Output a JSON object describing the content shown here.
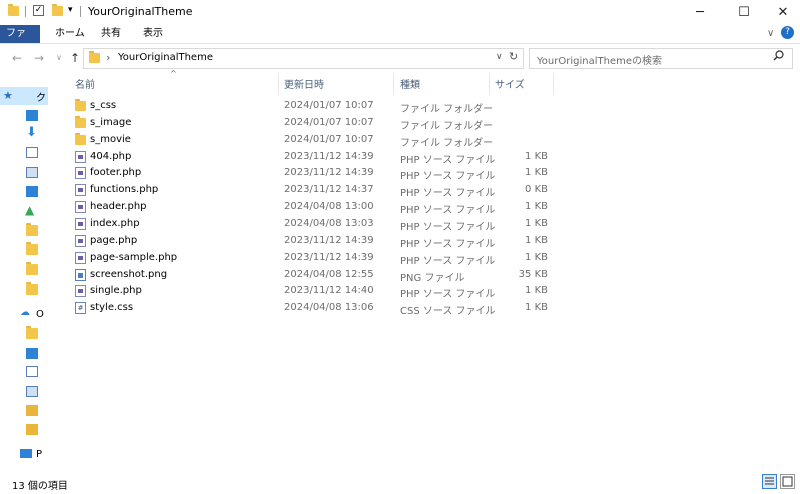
{
  "window": {
    "title": "YourOriginalTheme",
    "minimize": "─",
    "maximize": "☐",
    "close": "✕"
  },
  "ribbon": {
    "tabs": [
      "ファイル",
      "ホーム",
      "共有",
      "表示"
    ],
    "expand": "∨",
    "help": "?"
  },
  "address": {
    "path_separator": "›",
    "path": "YourOriginalTheme",
    "refresh": "↻",
    "dropdown": "∨"
  },
  "search": {
    "placeholder": "YourOriginalThemeの検索"
  },
  "nav": {
    "back": "←",
    "forward": "→",
    "recent": "∨",
    "up": "↑",
    "quick_access_label": "ク",
    "onedrive_label": "O",
    "pc_label": "P"
  },
  "columns": {
    "name": "名前",
    "date": "更新日時",
    "type": "種類",
    "size": "サイズ",
    "sort_indicator": "^"
  },
  "files": [
    {
      "name": "s_css",
      "date": "2024/01/07 10:07",
      "type": "ファイル フォルダー",
      "size": "",
      "icon": "folder-icon"
    },
    {
      "name": "s_image",
      "date": "2024/01/07 10:07",
      "type": "ファイル フォルダー",
      "size": "",
      "icon": "folder-icon"
    },
    {
      "name": "s_movie",
      "date": "2024/01/07 10:07",
      "type": "ファイル フォルダー",
      "size": "",
      "icon": "folder-icon"
    },
    {
      "name": "404.php",
      "date": "2023/11/12 14:39",
      "type": "PHP ソース ファイル",
      "size": "1 KB",
      "icon": "php-file-icon"
    },
    {
      "name": "footer.php",
      "date": "2023/11/12 14:39",
      "type": "PHP ソース ファイル",
      "size": "1 KB",
      "icon": "php-file-icon"
    },
    {
      "name": "functions.php",
      "date": "2023/11/12 14:37",
      "type": "PHP ソース ファイル",
      "size": "0 KB",
      "icon": "php-file-icon"
    },
    {
      "name": "header.php",
      "date": "2024/04/08 13:00",
      "type": "PHP ソース ファイル",
      "size": "1 KB",
      "icon": "php-file-icon"
    },
    {
      "name": "index.php",
      "date": "2024/04/08 13:03",
      "type": "PHP ソース ファイル",
      "size": "1 KB",
      "icon": "php-file-icon"
    },
    {
      "name": "page.php",
      "date": "2023/11/12 14:39",
      "type": "PHP ソース ファイル",
      "size": "1 KB",
      "icon": "php-file-icon"
    },
    {
      "name": "page-sample.php",
      "date": "2023/11/12 14:39",
      "type": "PHP ソース ファイル",
      "size": "1 KB",
      "icon": "php-file-icon"
    },
    {
      "name": "screenshot.png",
      "date": "2024/04/08 12:55",
      "type": "PNG ファイル",
      "size": "35 KB",
      "icon": "png-file-icon"
    },
    {
      "name": "single.php",
      "date": "2023/11/12 14:40",
      "type": "PHP ソース ファイル",
      "size": "1 KB",
      "icon": "php-file-icon"
    },
    {
      "name": "style.css",
      "date": "2024/04/08 13:06",
      "type": "CSS ソース ファイル",
      "size": "1 KB",
      "icon": "css-file-icon"
    }
  ],
  "status": {
    "item_count": "13 個の項目"
  },
  "colors": {
    "ribbon_file_tab": "#2b579a",
    "selection": "#cce8ff",
    "folder": "#f3c64b",
    "column_header_text": "#4c607a"
  }
}
